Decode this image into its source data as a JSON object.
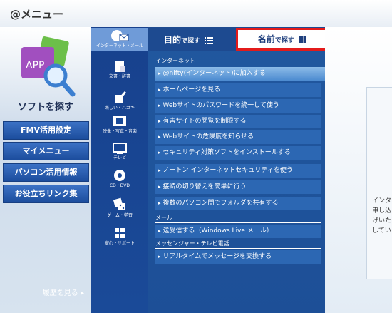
{
  "window": {
    "title": "@メニュー"
  },
  "left_nav": {
    "title": "ソフトを探す",
    "buttons": [
      "FMV活用設定",
      "マイメニュー",
      "パソコン活用情報",
      "お役立ちリンク集"
    ],
    "history": "履歴を見る ▸"
  },
  "categories": [
    {
      "label": "インターネット・メール",
      "icon": "globe-mail-icon",
      "active": true
    },
    {
      "label": "文書・辞書",
      "icon": "document-icon"
    },
    {
      "label": "楽しい・ハガキ",
      "icon": "pen-card-icon"
    },
    {
      "label": "映像・写真・音楽",
      "icon": "film-icon"
    },
    {
      "label": "テレビ",
      "icon": "tv-icon"
    },
    {
      "label": "CD・DVD",
      "icon": "disc-icon"
    },
    {
      "label": "ゲーム・学習",
      "icon": "dice-icon"
    },
    {
      "label": "安心・サポート",
      "icon": "gift-icon"
    }
  ],
  "tabs": {
    "purpose": {
      "main": "目的",
      "sub": "で探す",
      "icon": "list-icon"
    },
    "name": {
      "main": "名前",
      "sub": "で探す",
      "icon": "grid-icon"
    }
  },
  "sections": [
    {
      "title": "インターネット",
      "items": [
        "@nifty(インターネット)に加入する",
        "ホームページを見る",
        "Webサイトのパスワードを統一して使う",
        "有害サイトの閲覧を制限する",
        "Webサイトの危険度を知らせる",
        "セキュリティ対策ソフトをインストールする",
        "ノートン インターネットセキュリティを使う",
        "接続の切り替えを簡単に行う",
        "複数のパソコン間でフォルダを共有する"
      ]
    },
    {
      "title": "メール",
      "items": [
        "送受信する（Windows Live メール）"
      ]
    },
    {
      "title": "メッセンジャー・テレビ電話",
      "items": [
        "リアルタイムでメッセージを交換する"
      ]
    }
  ],
  "right_panel": {
    "lines": [
      "インタ",
      "申し込",
      "げいた",
      "してい"
    ]
  },
  "colors": {
    "accent": "#1d4f97",
    "highlight": "#e31b1b"
  }
}
